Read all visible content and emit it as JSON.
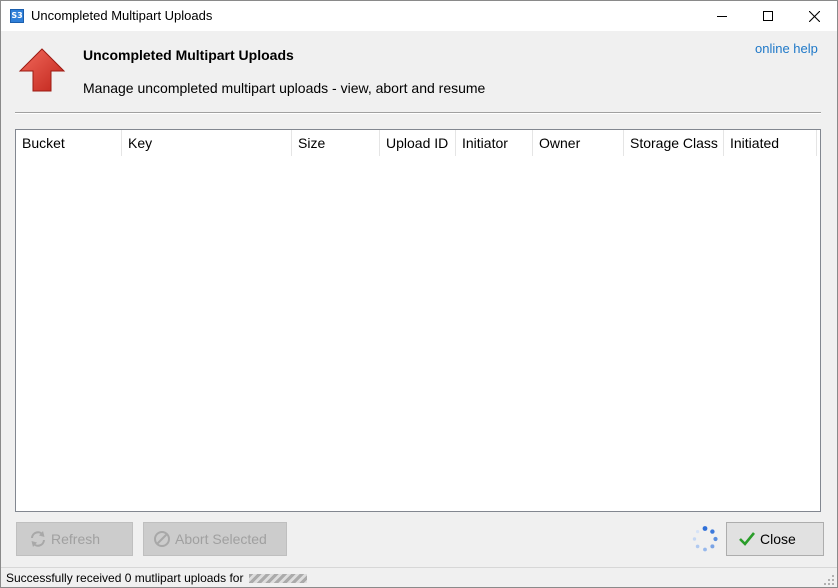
{
  "window": {
    "title": "Uncompleted Multipart Uploads",
    "icon_label": "S3"
  },
  "header": {
    "title": "Uncompleted Multipart Uploads",
    "description": "Manage uncompleted multipart uploads - view, abort and resume",
    "help_link": "online help",
    "icon": "red-up-arrow-icon"
  },
  "table": {
    "columns": [
      "Bucket",
      "Key",
      "Size",
      "Upload ID",
      "Initiator",
      "Owner",
      "Storage Class",
      "Initiated"
    ],
    "rows": []
  },
  "buttons": {
    "refresh": "Refresh",
    "abort": "Abort Selected",
    "close": "Close"
  },
  "status": {
    "text": "Successfully received 0 mutlipart uploads for"
  },
  "colors": {
    "link": "#1e78c8",
    "arrow": "#d9342b",
    "close_check": "#2a9d2a",
    "spinner": "#2f6fd8"
  }
}
